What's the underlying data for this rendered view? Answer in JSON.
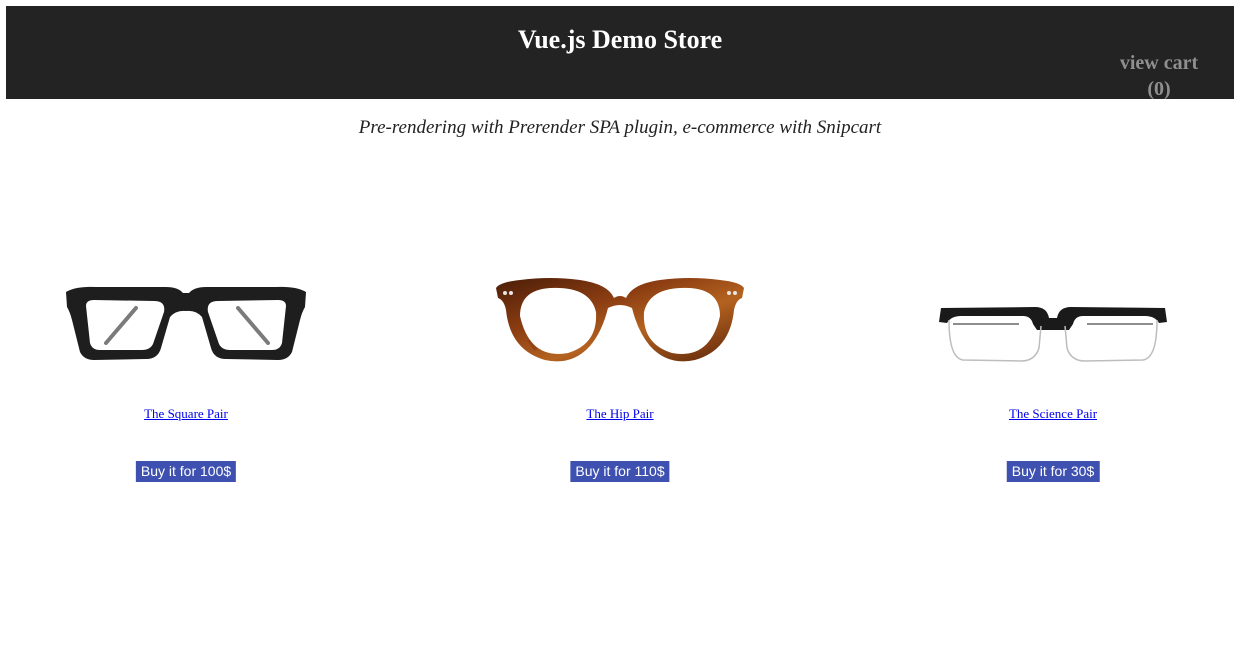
{
  "header": {
    "title": "Vue.js Demo Store",
    "cart_label": "view cart",
    "cart_count": "(0)"
  },
  "tagline": "Pre-rendering with Prerender SPA plugin, e-commerce with Snipcart",
  "products": [
    {
      "name": "The Square Pair",
      "buy_label": "Buy it for 100$",
      "image": "black-square-glasses"
    },
    {
      "name": "The Hip Pair",
      "buy_label": "Buy it for 110$",
      "image": "tortoise-round-glasses"
    },
    {
      "name": "The Science Pair",
      "buy_label": "Buy it for 30$",
      "image": "half-rim-glasses"
    }
  ],
  "colors": {
    "header_bg": "#232323",
    "header_text": "#ffffff",
    "cart_text": "#8f8f8f",
    "button_bg": "#3e50b0",
    "link": "#0000ee"
  }
}
